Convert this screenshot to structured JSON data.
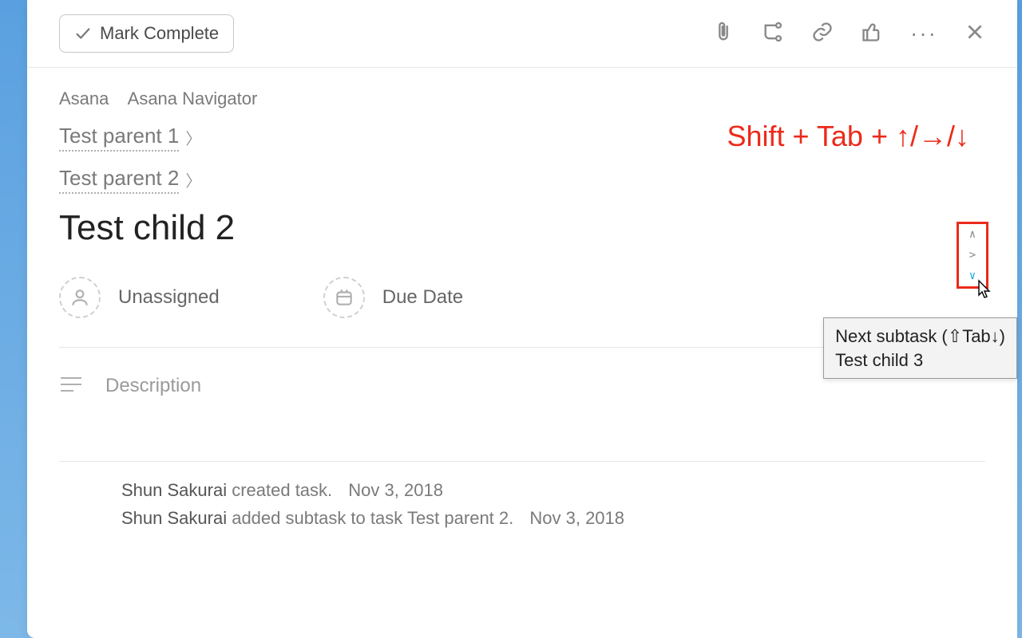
{
  "toolbar": {
    "mark_complete_label": "Mark Complete"
  },
  "breadcrumb": {
    "item1": "Asana",
    "item2": "Asana Navigator"
  },
  "parents": {
    "p1": "Test parent 1",
    "p2": "Test parent 2"
  },
  "task": {
    "title": "Test child 2"
  },
  "fields": {
    "assignee_label": "Unassigned",
    "due_label": "Due Date"
  },
  "description": {
    "placeholder": "Description"
  },
  "activity": {
    "a1_name": "Shun Sakurai",
    "a1_text": " created task.",
    "a1_date": "Nov 3, 2018",
    "a2_name": "Shun Sakurai",
    "a2_text": " added subtask to task Test parent 2.",
    "a2_date": "Nov 3, 2018"
  },
  "annotation": {
    "shortcut_text": "Shift + Tab + ↑/→/↓",
    "nav_up": "∧",
    "nav_right": ">",
    "nav_down": "∨",
    "tooltip_line1": "Next subtask (⇧Tab↓)",
    "tooltip_line2": "Test child 3"
  }
}
